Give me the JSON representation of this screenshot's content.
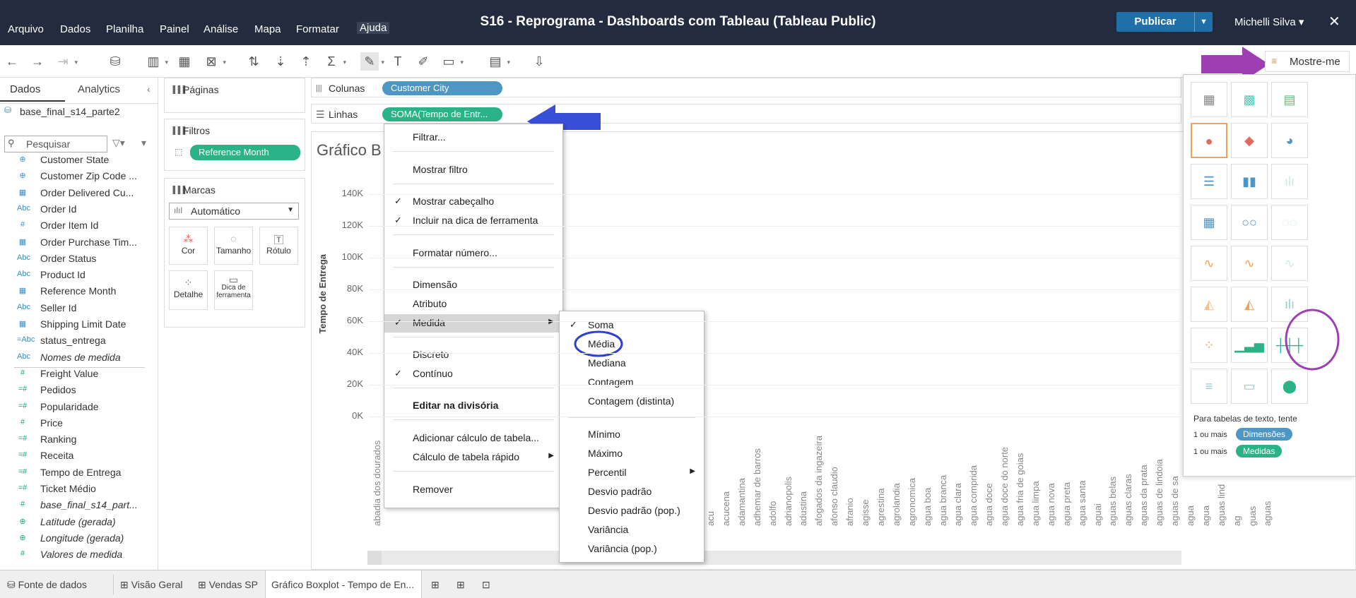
{
  "window": {
    "title": "S16 - Reprograma - Dashboards com Tableau (Tableau Public)"
  },
  "menu": [
    "Arquivo",
    "Dados",
    "Planilha",
    "Painel",
    "Análise",
    "Mapa",
    "Formatar",
    "Ajuda"
  ],
  "header": {
    "publish_label": "Publicar",
    "user_name": "Michelli Silva"
  },
  "showme": {
    "label": "Mostre-me",
    "hint": "Para tabelas de texto, tente",
    "req1": "1 ou mais",
    "dim": "Dimensões",
    "req2": "1 ou mais",
    "meas": "Medidas"
  },
  "left_pane": {
    "tab_data": "Dados",
    "tab_analytics": "Analytics",
    "datasource": "base_final_s14_parte2",
    "search_placeholder": "Pesquisar",
    "fields": [
      {
        "icon": "globe",
        "label": "Customer State"
      },
      {
        "icon": "globe",
        "label": "Customer Zip Code ..."
      },
      {
        "icon": "date",
        "label": "Order Delivered Cu..."
      },
      {
        "icon": "Abc",
        "label": "Order Id"
      },
      {
        "icon": "#",
        "label": "Order Item Id"
      },
      {
        "icon": "date",
        "label": "Order Purchase Tim..."
      },
      {
        "icon": "Abc",
        "label": "Order Status"
      },
      {
        "icon": "Abc",
        "label": "Product Id"
      },
      {
        "icon": "date",
        "label": "Reference Month"
      },
      {
        "icon": "Abc",
        "label": "Seller Id"
      },
      {
        "icon": "date",
        "label": "Shipping Limit Date"
      },
      {
        "icon": "=Abc",
        "label": "status_entrega"
      },
      {
        "icon": "Abc",
        "label": "Nomes de medida"
      },
      {
        "icon": "#",
        "label": "Freight Value"
      },
      {
        "icon": "=#",
        "label": "Pedidos"
      },
      {
        "icon": "=#",
        "label": "Popularidade"
      },
      {
        "icon": "#",
        "label": "Price"
      },
      {
        "icon": "=#",
        "label": "Ranking"
      },
      {
        "icon": "=#",
        "label": "Receita"
      },
      {
        "icon": "=#",
        "label": "Tempo de Entrega"
      },
      {
        "icon": "=#",
        "label": "Ticket Médio"
      },
      {
        "icon": "#",
        "label": "base_final_s14_part..."
      },
      {
        "icon": "globe",
        "label": "Latitude (gerada)"
      },
      {
        "icon": "globe",
        "label": "Longitude (gerada)"
      },
      {
        "icon": "#",
        "label": "Valores de medida"
      }
    ]
  },
  "cards": {
    "pages": "Páginas",
    "filters": "Filtros",
    "filter_pill": "Reference Month",
    "marks": "Marcas",
    "mark_type": "Automático",
    "mark_buttons": [
      "Cor",
      "Tamanho",
      "Rótulo",
      "Detalhe",
      "Dica de ferramenta"
    ]
  },
  "shelves": {
    "columns_label": "Colunas",
    "columns_pill": "Customer City",
    "rows_label": "Linhas",
    "rows_pill": "SOMA(Tempo de Entr..."
  },
  "chart_data": {
    "type": "bar",
    "title": "Gráfico B                                      ga",
    "ylabel": "Tempo de Entrega",
    "yticks": [
      "140K",
      "120K",
      "100K",
      "80K",
      "60K",
      "40K",
      "20K",
      "0K"
    ],
    "ylim": [
      0,
      140000
    ],
    "categories": [
      "abadia dos dourados",
      "acu",
      "acucena",
      "adamantina",
      "adhemar de barros",
      "adolfo",
      "adrianopolis",
      "adustina",
      "afogados da ingazeira",
      "afonso claudio",
      "afranio",
      "agisse",
      "agrestina",
      "agrolandia",
      "agronomica",
      "agua boa",
      "agua branca",
      "agua clara",
      "agua comprida",
      "agua doce",
      "agua doce do norte",
      "agua fria de goias",
      "agua limpa",
      "agua nova",
      "agua preta",
      "agua santa",
      "aguai",
      "aguas belas",
      "aguas claras",
      "aguas da prata",
      "aguas de lindoia",
      "aguas de sa",
      "agua",
      "agua",
      "aguas lind",
      "ag",
      "guas",
      "aguas"
    ]
  },
  "context_menu": {
    "items": [
      "Filtrar...",
      "Mostrar filtro",
      "Mostrar cabeçalho",
      "Incluir na dica de ferramenta",
      "Formatar número...",
      "Dimensão",
      "Atributo",
      "Medida",
      "Discreto",
      "Contínuo",
      "Editar na divisória",
      "Adicionar cálculo de tabela...",
      "Cálculo de tabela rápido",
      "Remover"
    ]
  },
  "submenu": {
    "items": [
      "Soma",
      "Média",
      "Mediana",
      "Contagem",
      "Contagem (distinta)",
      "Mínimo",
      "Máximo",
      "Percentil",
      "Desvio padrão",
      "Desvio padrão (pop.)",
      "Variância",
      "Variância (pop.)"
    ]
  },
  "sheet_tabs": {
    "datasource": "Fonte de dados",
    "tabs": [
      "Visão Geral",
      "Vendas SP",
      "Gráfico Boxplot - Tempo de En..."
    ]
  }
}
